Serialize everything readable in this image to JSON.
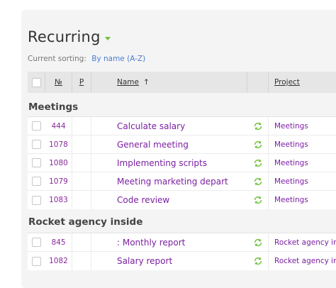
{
  "page": {
    "title": "Recurring",
    "sorting_label": "Current sorting:",
    "sorting_value": "By name (A-Z)"
  },
  "columns": {
    "number": "№",
    "p": "P",
    "name": "Name",
    "name_sort_arrow": "↑",
    "project": "Project"
  },
  "groups": [
    {
      "title": "Meetings",
      "rows": [
        {
          "number": "444",
          "name": "Calculate salary",
          "project": "Meetings"
        },
        {
          "number": "1078",
          "name": "General meeting",
          "project": "Meetings"
        },
        {
          "number": "1080",
          "name": "Implementing scripts",
          "project": "Meetings"
        },
        {
          "number": "1079",
          "name": "Meeting marketing depart",
          "project": "Meetings"
        },
        {
          "number": "1083",
          "name": "Code review",
          "project": "Meetings"
        }
      ]
    },
    {
      "title": "Rocket agency inside",
      "rows": [
        {
          "number": "845",
          "name": ": Monthly report",
          "project": "Rocket agency inside"
        },
        {
          "number": "1082",
          "name": "Salary report",
          "project": "Rocket agency inside"
        }
      ]
    }
  ],
  "colors": {
    "accent_green": "#6fbf3a",
    "link_purple": "#7b1fa2",
    "link_blue": "#4a7bd0"
  },
  "icons": {
    "row_icon": "recurring-icon",
    "title_caret": "caret-down-icon"
  }
}
